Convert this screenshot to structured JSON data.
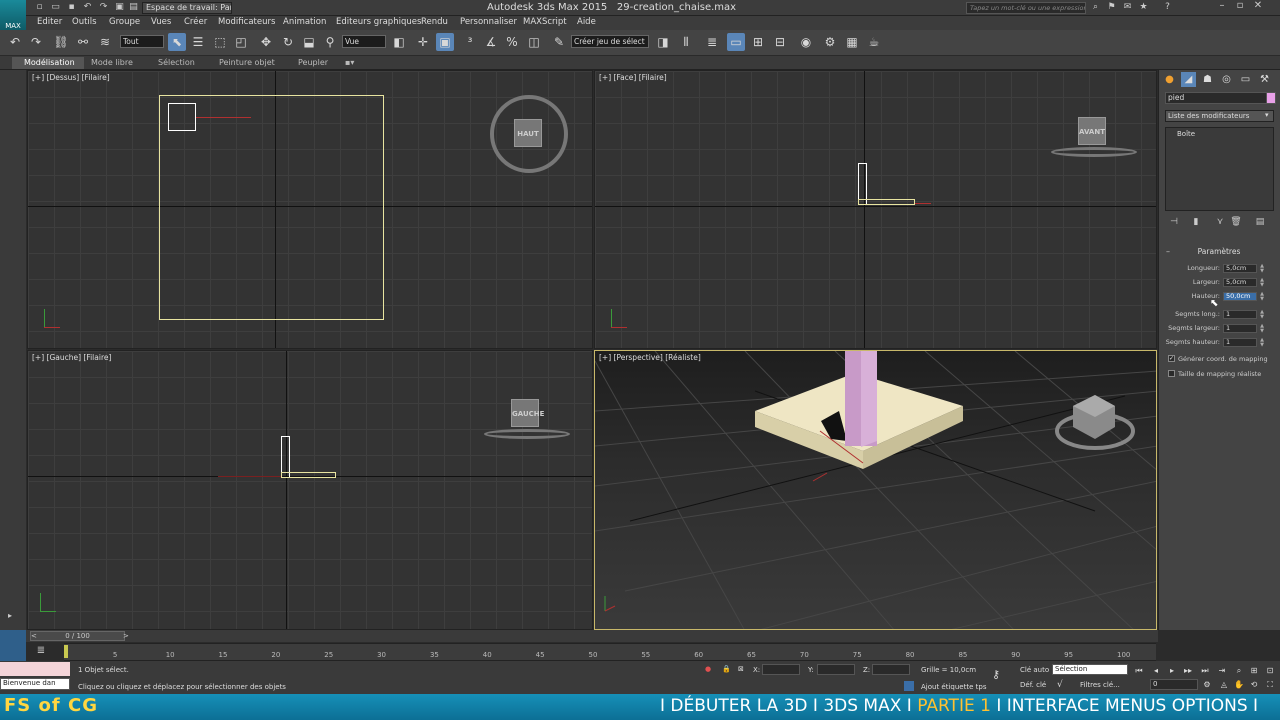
{
  "window": {
    "app_title": "Autodesk 3ds Max  2015",
    "file_name": "29-creation_chaise.max",
    "workspace": "Espace de travail: Par",
    "search_placeholder": "Tapez un mot-clé ou une expression"
  },
  "menu": [
    "Editer",
    "Outils",
    "Groupe",
    "Vues",
    "Créer",
    "Modificateurs",
    "Animation",
    "Editeurs graphiques",
    "Rendu",
    "Personnaliser",
    "MAXScript",
    "Aide"
  ],
  "toolbar": {
    "selection_filter": "Tout",
    "ref_coord": "Vue",
    "named_selection": "Créer jeu de sélect"
  },
  "ribbon_tabs": [
    "Modélisation",
    "Mode libre",
    "Sélection",
    "Peinture objet",
    "Peupler"
  ],
  "viewports": {
    "top": {
      "label": "[+] [Dessus] [Filaire]",
      "cube": "HAUT"
    },
    "front": {
      "label": "[+] [Face] [Filaire]",
      "cube": "AVANT"
    },
    "left": {
      "label": "[+] [Gauche] [Filaire]",
      "cube": "GAUCHE"
    },
    "persp": {
      "label": "[+] [Perspective] [Réaliste]"
    }
  },
  "command_panel": {
    "object_name": "pied",
    "object_color": "#e8a0e8",
    "modifier_list": "Liste des modificateurs",
    "stack_item": "Boîte",
    "rollout_title": "Paramètres",
    "params": [
      {
        "label": "Longueur:",
        "value": "5,0cm"
      },
      {
        "label": "Largeur:",
        "value": "5,0cm"
      },
      {
        "label": "Hauteur:",
        "value": "50,0cm"
      },
      {
        "label": "Segmts long.:",
        "value": "1"
      },
      {
        "label": "Segmts largeur:",
        "value": "1"
      },
      {
        "label": "Segmts hauteur:",
        "value": "1"
      }
    ],
    "checkboxes": [
      {
        "label": "Générer coord. de mapping",
        "checked": true
      },
      {
        "label": "Taille de mapping réaliste",
        "checked": false
      }
    ]
  },
  "timeline": {
    "frame_display": "0 / 100",
    "ticks": [
      "5",
      "10",
      "15",
      "20",
      "25",
      "30",
      "35",
      "40",
      "45",
      "50",
      "55",
      "60",
      "65",
      "70",
      "75",
      "80",
      "85",
      "90",
      "95",
      "100"
    ]
  },
  "status": {
    "welcome": "Bienvenue dan",
    "selected": "1 Objet sélect.",
    "prompt": "Cliquez ou cliquez et déplacez pour sélectionner des objets",
    "x_label": "X:",
    "y_label": "Y:",
    "z_label": "Z:",
    "grid": "Grille = 10,0cm",
    "add_key": "Ajout étiquette tps",
    "auto_key": "Clé auto",
    "set_key": "Déf. clé",
    "key_mode": "Sélection",
    "key_filters": "Filtres clé...",
    "current_frame": "0"
  },
  "banner": {
    "logo": "FS of CG",
    "seg1": "I DÉBUTER LA 3D I 3DS MAX I ",
    "seg2": "PARTIE 1",
    "seg3": " I INTERFACE MENUS OPTIONS I"
  }
}
